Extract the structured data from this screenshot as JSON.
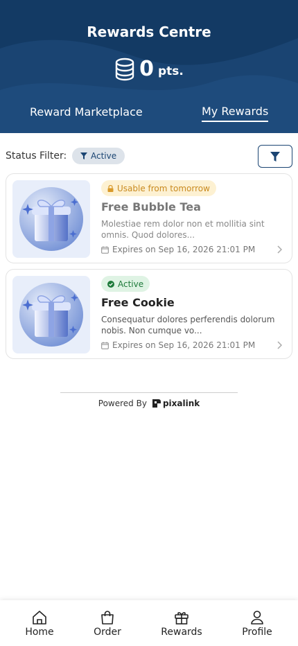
{
  "header": {
    "title": "Rewards Centre",
    "points_value": "0",
    "points_unit": "pts."
  },
  "tabs": [
    {
      "label": "Reward Marketplace",
      "active": false
    },
    {
      "label": "My Rewards",
      "active": true
    }
  ],
  "filter": {
    "label": "Status Filter:",
    "chip": "Active"
  },
  "rewards": [
    {
      "badge": "Usable from tomorrow",
      "badge_type": "warning",
      "title": "Free Bubble Tea",
      "description": "Molestiae rem dolor non et mollitia sint omnis. Quod dolores...",
      "expiry": "Expires on Sep 16, 2026 21:01 PM"
    },
    {
      "badge": "Active",
      "badge_type": "success",
      "title": "Free Cookie",
      "description": "Consequatur dolores perferendis dolorum nobis. Non cumque vo...",
      "expiry": "Expires on Sep 16, 2026 21:01 PM"
    }
  ],
  "footer": {
    "powered_by": "Powered By",
    "brand": "pixalink"
  },
  "bottom_nav": [
    {
      "label": "Home",
      "icon": "home-icon"
    },
    {
      "label": "Order",
      "icon": "bag-icon"
    },
    {
      "label": "Rewards",
      "icon": "gift-icon"
    },
    {
      "label": "Profile",
      "icon": "user-icon"
    }
  ],
  "colors": {
    "primary": "#1a4472",
    "warning_bg": "#fdf1d2",
    "success_bg": "#dff3e4"
  }
}
